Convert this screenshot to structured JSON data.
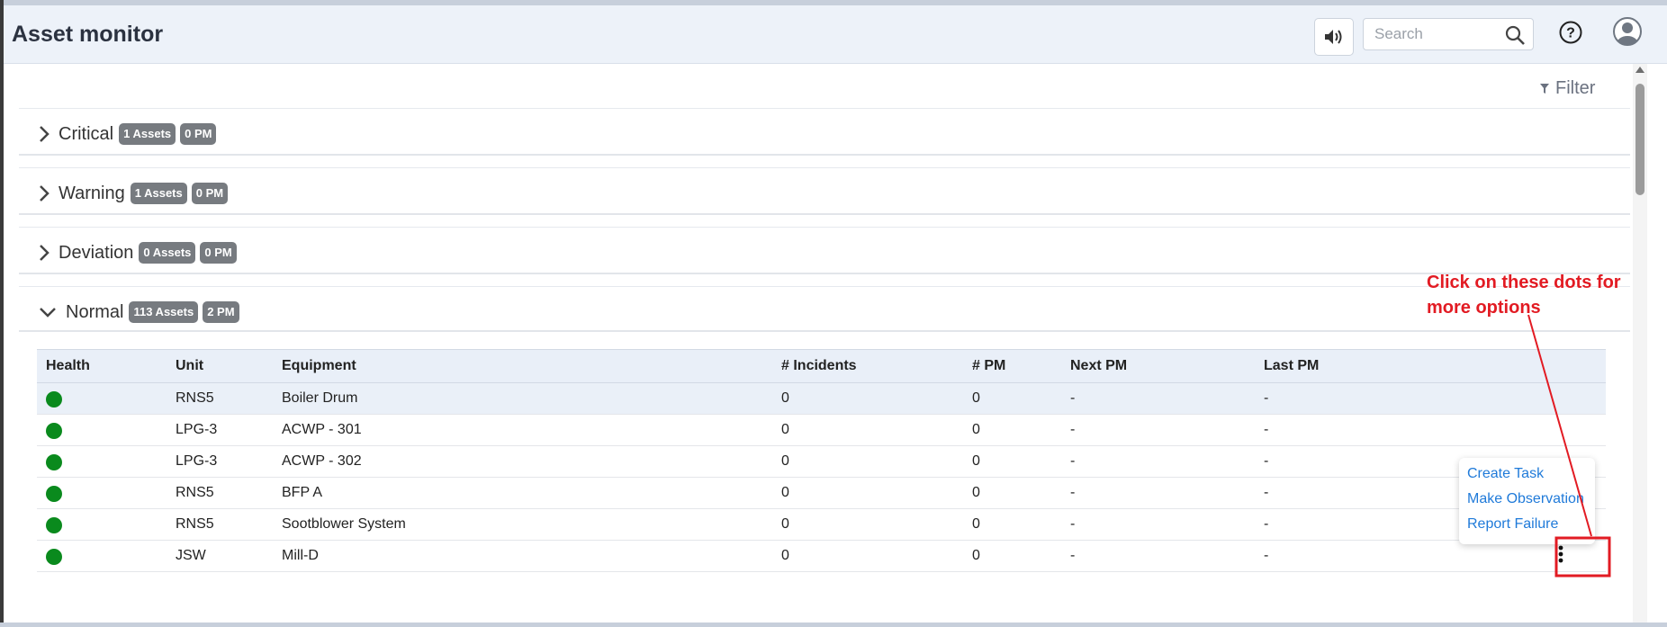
{
  "header": {
    "title": "Asset monitor",
    "search_placeholder": "Search"
  },
  "toolbar": {
    "filter_label": "Filter"
  },
  "sections": [
    {
      "label": "Critical",
      "assets_badge": "1 Assets",
      "pm_badge": "0 PM",
      "expanded": false
    },
    {
      "label": "Warning",
      "assets_badge": "1 Assets",
      "pm_badge": "0 PM",
      "expanded": false
    },
    {
      "label": "Deviation",
      "assets_badge": "0 Assets",
      "pm_badge": "0 PM",
      "expanded": false
    },
    {
      "label": "Normal",
      "assets_badge": "113 Assets",
      "pm_badge": "2 PM",
      "expanded": true
    }
  ],
  "table": {
    "columns": [
      "Health",
      "Unit",
      "Equipment",
      "# Incidents",
      "# PM",
      "Next PM",
      "Last PM"
    ],
    "rows": [
      {
        "unit": "RNS5",
        "equipment": "Boiler Drum",
        "incidents": "0",
        "pm": "0",
        "next_pm": "-",
        "last_pm": "-"
      },
      {
        "unit": "LPG-3",
        "equipment": "ACWP - 301",
        "incidents": "0",
        "pm": "0",
        "next_pm": "-",
        "last_pm": "-"
      },
      {
        "unit": "LPG-3",
        "equipment": "ACWP - 302",
        "incidents": "0",
        "pm": "0",
        "next_pm": "-",
        "last_pm": "-"
      },
      {
        "unit": "RNS5",
        "equipment": "BFP A",
        "incidents": "0",
        "pm": "0",
        "next_pm": "-",
        "last_pm": "-"
      },
      {
        "unit": "RNS5",
        "equipment": "Sootblower System",
        "incidents": "0",
        "pm": "0",
        "next_pm": "-",
        "last_pm": "-"
      },
      {
        "unit": "JSW",
        "equipment": "Mill-D",
        "incidents": "0",
        "pm": "0",
        "next_pm": "-",
        "last_pm": "-"
      }
    ],
    "health_color": "#0a8a1d"
  },
  "context_menu": {
    "items": [
      "Create Task",
      "Make Observation",
      "Report Failure"
    ]
  },
  "annotation": {
    "text_line1": "Click on these dots for",
    "text_line2": "more options",
    "color": "#e21b23"
  }
}
